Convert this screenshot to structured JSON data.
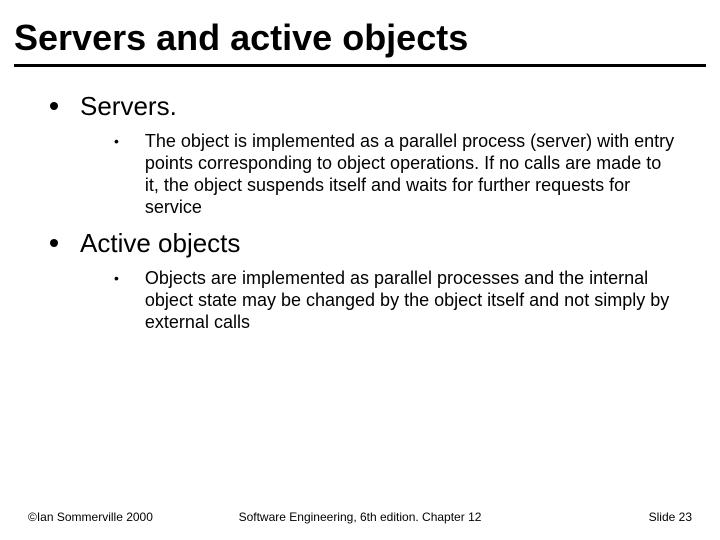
{
  "title": "Servers and active objects",
  "items": [
    {
      "heading": "Servers.",
      "sub": [
        "The object is implemented as a parallel process (server) with entry points corresponding to object operations. If no calls are made to it, the object suspends itself and waits for further requests for service"
      ]
    },
    {
      "heading": "Active objects",
      "sub": [
        "Objects are implemented as parallel processes and the internal object state may be changed by the object itself and not simply by external calls"
      ]
    }
  ],
  "footer": {
    "left": "©Ian Sommerville 2000",
    "center": "Software Engineering, 6th edition. Chapter 12",
    "right": "Slide 23"
  }
}
